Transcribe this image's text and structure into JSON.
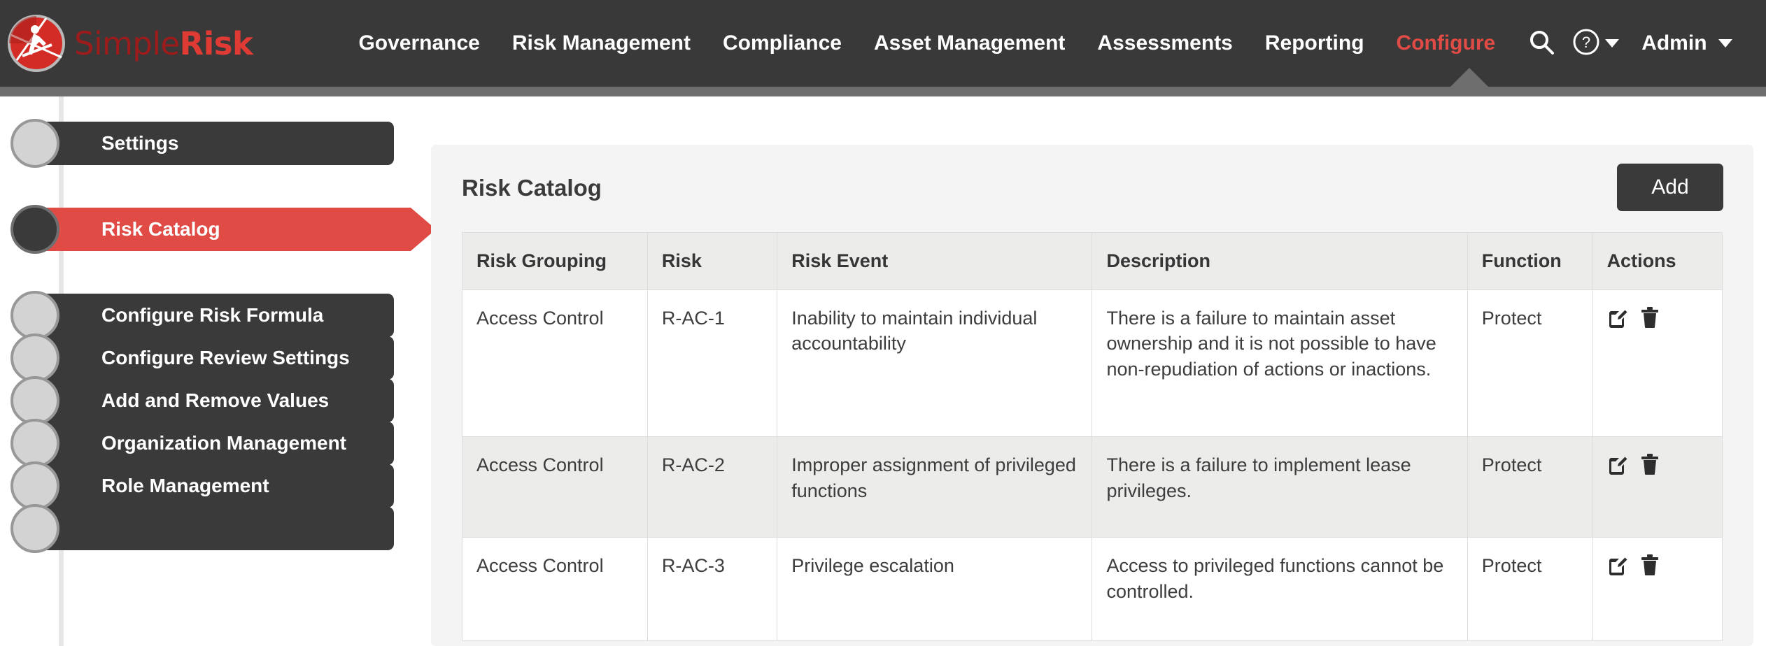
{
  "brand": {
    "name_part1": "Simple",
    "name_part2": "Risk",
    "logo_icon": "simplerisk-skier-logo-icon"
  },
  "topnav": {
    "items": [
      {
        "label": "Governance",
        "active": false
      },
      {
        "label": "Risk Management",
        "active": false
      },
      {
        "label": "Compliance",
        "active": false
      },
      {
        "label": "Asset Management",
        "active": false
      },
      {
        "label": "Assessments",
        "active": false
      },
      {
        "label": "Reporting",
        "active": false
      },
      {
        "label": "Configure",
        "active": true
      }
    ],
    "search_icon": "search-icon",
    "help_icon": "question-circle-icon",
    "help_caret_icon": "chevron-down-icon",
    "admin_label": "Admin",
    "admin_caret_icon": "chevron-down-icon",
    "active_color": "#e04b45",
    "bar_color": "#393939",
    "strip_color": "#6e6e6e"
  },
  "sidebar": {
    "items": [
      {
        "label": "Settings",
        "active": false
      },
      {
        "label": "Risk Catalog",
        "active": true
      },
      {
        "label": "Configure Risk Formula",
        "active": false
      },
      {
        "label": "Configure Review Settings",
        "active": false
      },
      {
        "label": "Add and Remove Values",
        "active": false
      },
      {
        "label": "Organization Management",
        "active": false
      },
      {
        "label": "Role Management",
        "active": false
      },
      {
        "label": "",
        "active": false
      }
    ]
  },
  "panel": {
    "title": "Risk Catalog",
    "add_label": "Add"
  },
  "table": {
    "columns": [
      "Risk Grouping",
      "Risk",
      "Risk Event",
      "Description",
      "Function",
      "Actions"
    ],
    "rows": [
      {
        "grouping": "Access Control",
        "risk": "R-AC-1",
        "event": "Inability to maintain individual accountability",
        "description": "There is a failure to maintain asset ownership and it is not possible to have non-repudiation of actions or inactions.",
        "function": "Protect",
        "edit_icon": "edit-pencil-square-icon",
        "delete_icon": "trash-can-icon"
      },
      {
        "grouping": "Access Control",
        "risk": "R-AC-2",
        "event": "Improper assignment of privileged functions",
        "description": "There is a failure to implement lease privileges.",
        "function": "Protect",
        "edit_icon": "edit-pencil-square-icon",
        "delete_icon": "trash-can-icon"
      },
      {
        "grouping": "Access Control",
        "risk": "R-AC-3",
        "event": "Privilege escalation",
        "description": "Access to privileged functions cannot be controlled.",
        "function": "Protect",
        "edit_icon": "edit-pencil-square-icon",
        "delete_icon": "trash-can-icon"
      }
    ]
  }
}
